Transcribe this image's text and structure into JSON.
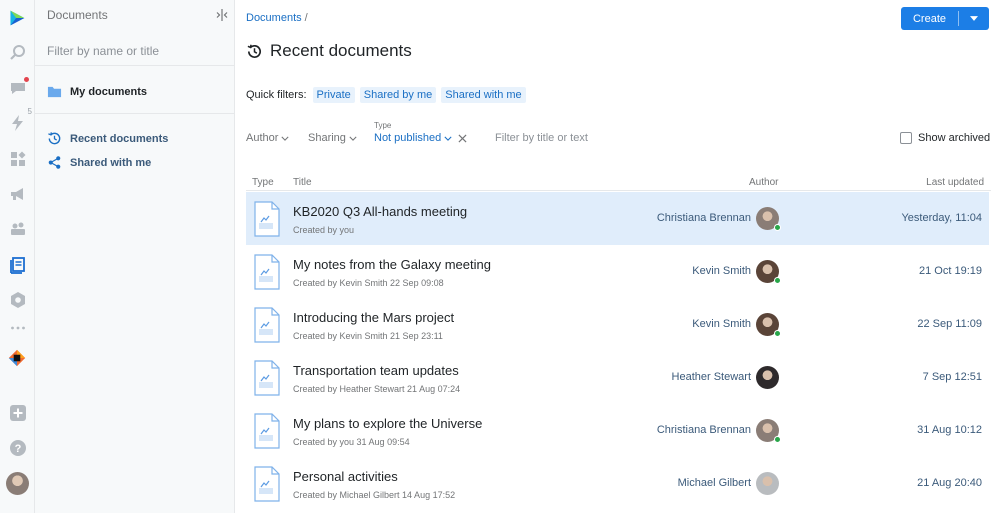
{
  "sidebar": {
    "header": "Documents",
    "filter_placeholder": "Filter by name or title",
    "my_documents": "My documents",
    "recent_documents": "Recent documents",
    "shared_with_me": "Shared with me"
  },
  "rail": {
    "notification_count": "5"
  },
  "breadcrumb": {
    "root": "Documents",
    "separator": "/"
  },
  "header": {
    "create_label": "Create",
    "title": "Recent documents"
  },
  "quick_filters": {
    "label": "Quick filters:",
    "chips": [
      "Private",
      "Shared by me",
      "Shared with me"
    ]
  },
  "filters": {
    "author": "Author",
    "sharing": "Sharing",
    "type_caption": "Type",
    "type_value": "Not published",
    "text_placeholder": "Filter by title or text",
    "show_archived": "Show archived"
  },
  "table": {
    "columns": {
      "type": "Type",
      "title": "Title",
      "author": "Author",
      "last_updated": "Last updated"
    },
    "rows": [
      {
        "title": "KB2020 Q3 All-hands meeting",
        "subtitle": "Created by you",
        "author": "Christiana Brennan",
        "updated": "Yesterday, 11:04",
        "selected": true,
        "online": true,
        "avatar_color": "#8a7d76"
      },
      {
        "title": "My notes from the Galaxy meeting",
        "subtitle": "Created by Kevin Smith 22 Sep 09:08",
        "author": "Kevin Smith",
        "updated": "21 Oct 19:19",
        "selected": false,
        "online": true,
        "avatar_color": "#5a4438"
      },
      {
        "title": "Introducing the Mars project",
        "subtitle": "Created by Kevin Smith 21 Sep 23:11",
        "author": "Kevin Smith",
        "updated": "22 Sep 11:09",
        "selected": false,
        "online": true,
        "avatar_color": "#5a4438"
      },
      {
        "title": "Transportation team updates",
        "subtitle": "Created by Heather Stewart 21 Aug 07:24",
        "author": "Heather Stewart",
        "updated": "7 Sep 12:51",
        "selected": false,
        "online": false,
        "avatar_color": "#2e2a2c"
      },
      {
        "title": "My plans to explore the Universe",
        "subtitle": "Created by you 31 Aug 09:54",
        "author": "Christiana Brennan",
        "updated": "31 Aug 10:12",
        "selected": false,
        "online": true,
        "avatar_color": "#8a7d76"
      },
      {
        "title": "Personal activities",
        "subtitle": "Created by Michael Gilbert 14 Aug 17:52",
        "author": "Michael Gilbert",
        "updated": "21 Aug 20:40",
        "selected": false,
        "online": false,
        "avatar_color": "#b9bcbf"
      }
    ]
  },
  "colors": {
    "accent": "#1c7ee6",
    "link": "#1a6fc4",
    "selected_row": "#e0edfb",
    "online": "#29a64a"
  }
}
